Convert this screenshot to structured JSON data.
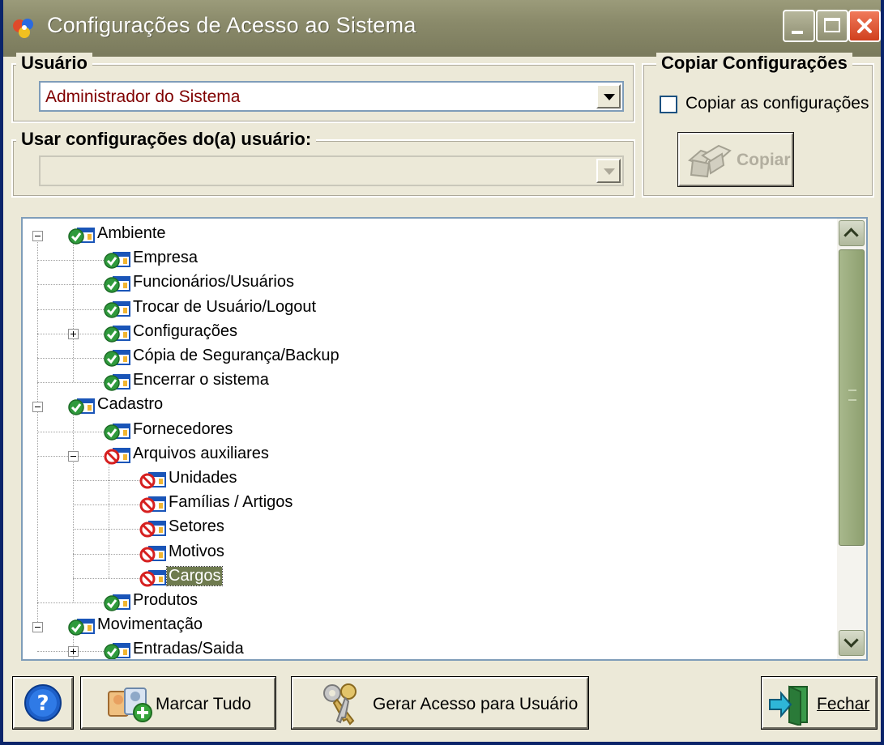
{
  "window": {
    "title": "Configurações de Acesso ao Sistema",
    "titlebar_color": "#8a8a6a"
  },
  "usuario": {
    "legend": "Usuário",
    "selected": "Administrador do Sistema"
  },
  "usar_config": {
    "legend": "Usar configurações do(a) usuário:",
    "selected": ""
  },
  "copiar": {
    "legend": "Copiar Configurações",
    "checkbox_label": "Copiar as configurações",
    "checked": false,
    "button_label": "Copiar"
  },
  "tree": {
    "nodes": [
      {
        "label": "Ambiente",
        "status": "allowed",
        "expanded": true
      },
      {
        "label": "Empresa",
        "status": "allowed"
      },
      {
        "label": "Funcionários/Usuários",
        "status": "allowed"
      },
      {
        "label": "Trocar de Usuário/Logout",
        "status": "allowed"
      },
      {
        "label": "Configurações",
        "status": "allowed",
        "expanded": false
      },
      {
        "label": "Cópia de Segurança/Backup",
        "status": "allowed"
      },
      {
        "label": "Encerrar o sistema",
        "status": "allowed"
      },
      {
        "label": "Cadastro",
        "status": "allowed",
        "expanded": true
      },
      {
        "label": "Fornecedores",
        "status": "allowed"
      },
      {
        "label": "Arquivos auxiliares",
        "status": "denied",
        "expanded": true
      },
      {
        "label": "Unidades",
        "status": "denied"
      },
      {
        "label": "Famílias / Artigos",
        "status": "denied"
      },
      {
        "label": "Setores",
        "status": "denied"
      },
      {
        "label": "Motivos",
        "status": "denied"
      },
      {
        "label": "Cargos",
        "status": "denied",
        "selected": true
      },
      {
        "label": "Produtos",
        "status": "allowed"
      },
      {
        "label": "Movimentação",
        "status": "allowed",
        "expanded": true
      },
      {
        "label": "Entradas/Saida",
        "status": "allowed",
        "expanded": false
      }
    ]
  },
  "buttons": {
    "marcar_tudo": "Marcar Tudo",
    "gerar_acesso": "Gerar Acesso para Usuário",
    "fechar": "Fechar"
  },
  "icons": {
    "allowed": "green-check-icon",
    "denied": "red-prohibited-icon"
  },
  "colors": {
    "selected_text": "#800000",
    "selection_bg": "#6f7b4f"
  }
}
